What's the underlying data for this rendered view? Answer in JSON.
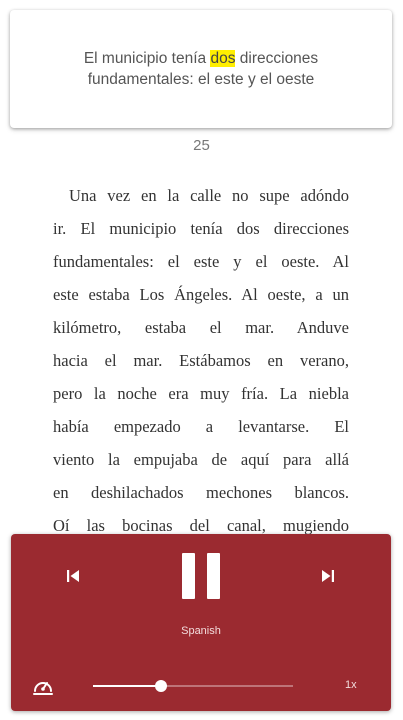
{
  "sentence_card": {
    "before": "El municipio tenía ",
    "highlight": "dos",
    "after": " direcciones fundamentales: el este y el oeste"
  },
  "page_number": "25",
  "book_lines": [
    "Una vez en la calle no supe adóndo",
    "ir. El municipio tenía dos direcciones",
    "fundamentales: el este y el oeste. Al",
    "este estaba Los Ángeles. Al oeste, a un",
    "kilómetro, estaba el mar. Anduve",
    "hacia el mar. Estábamos en verano,",
    "pero la noche era muy fría. La niebla",
    "había empezado a levantarse. El",
    "viento la empujaba de aquí para allá",
    "en deshilachados mechones blancos.",
    "Oí las bocinas del canal, mugiendo"
  ],
  "player": {
    "language": "Spanish",
    "speed": "1x",
    "progress": 0.34,
    "icons": {
      "previous": "skip-previous-icon",
      "pause": "pause-icon",
      "next": "skip-next-icon",
      "speed": "speedometer-icon"
    }
  },
  "colors": {
    "player_bg": "#9b2a30",
    "highlight": "#ffee00"
  }
}
